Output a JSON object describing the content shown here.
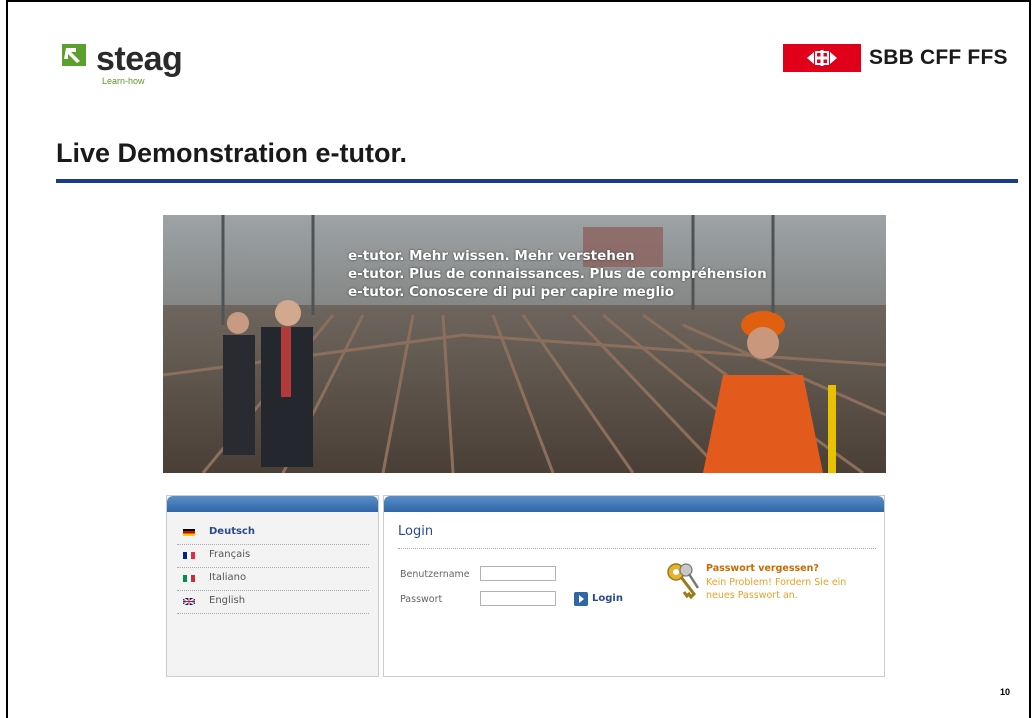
{
  "header": {
    "steag_wordmark": "steag",
    "steag_tagline": "Learn-how",
    "sbb_wordmark": "SBB CFF FFS"
  },
  "slide": {
    "title": "Live Demonstration e-tutor.",
    "page_number": "10",
    "accent_color": "#1b3c86"
  },
  "hero": {
    "lines": [
      "e-tutor. Mehr wissen. Mehr verstehen",
      "e-tutor. Plus de connaissances. Plus de compréhension",
      "e-tutor. Conoscere di pui per capire meglio"
    ]
  },
  "languages": [
    {
      "label": "Deutsch",
      "flag_icon": "germany-flag-icon",
      "active": true
    },
    {
      "label": "Français",
      "flag_icon": "france-flag-icon",
      "active": false
    },
    {
      "label": "Italiano",
      "flag_icon": "italy-flag-icon",
      "active": false
    },
    {
      "label": "English",
      "flag_icon": "uk-flag-icon",
      "active": false
    }
  ],
  "login": {
    "title": "Login",
    "username_label": "Benutzername",
    "password_label": "Passwort",
    "username_value": "",
    "password_value": "",
    "submit_label": "Login",
    "forgot_title": "Passwort vergessen?",
    "forgot_text": "Kein Problem! Fordern Sie ein neues Passwort an."
  }
}
